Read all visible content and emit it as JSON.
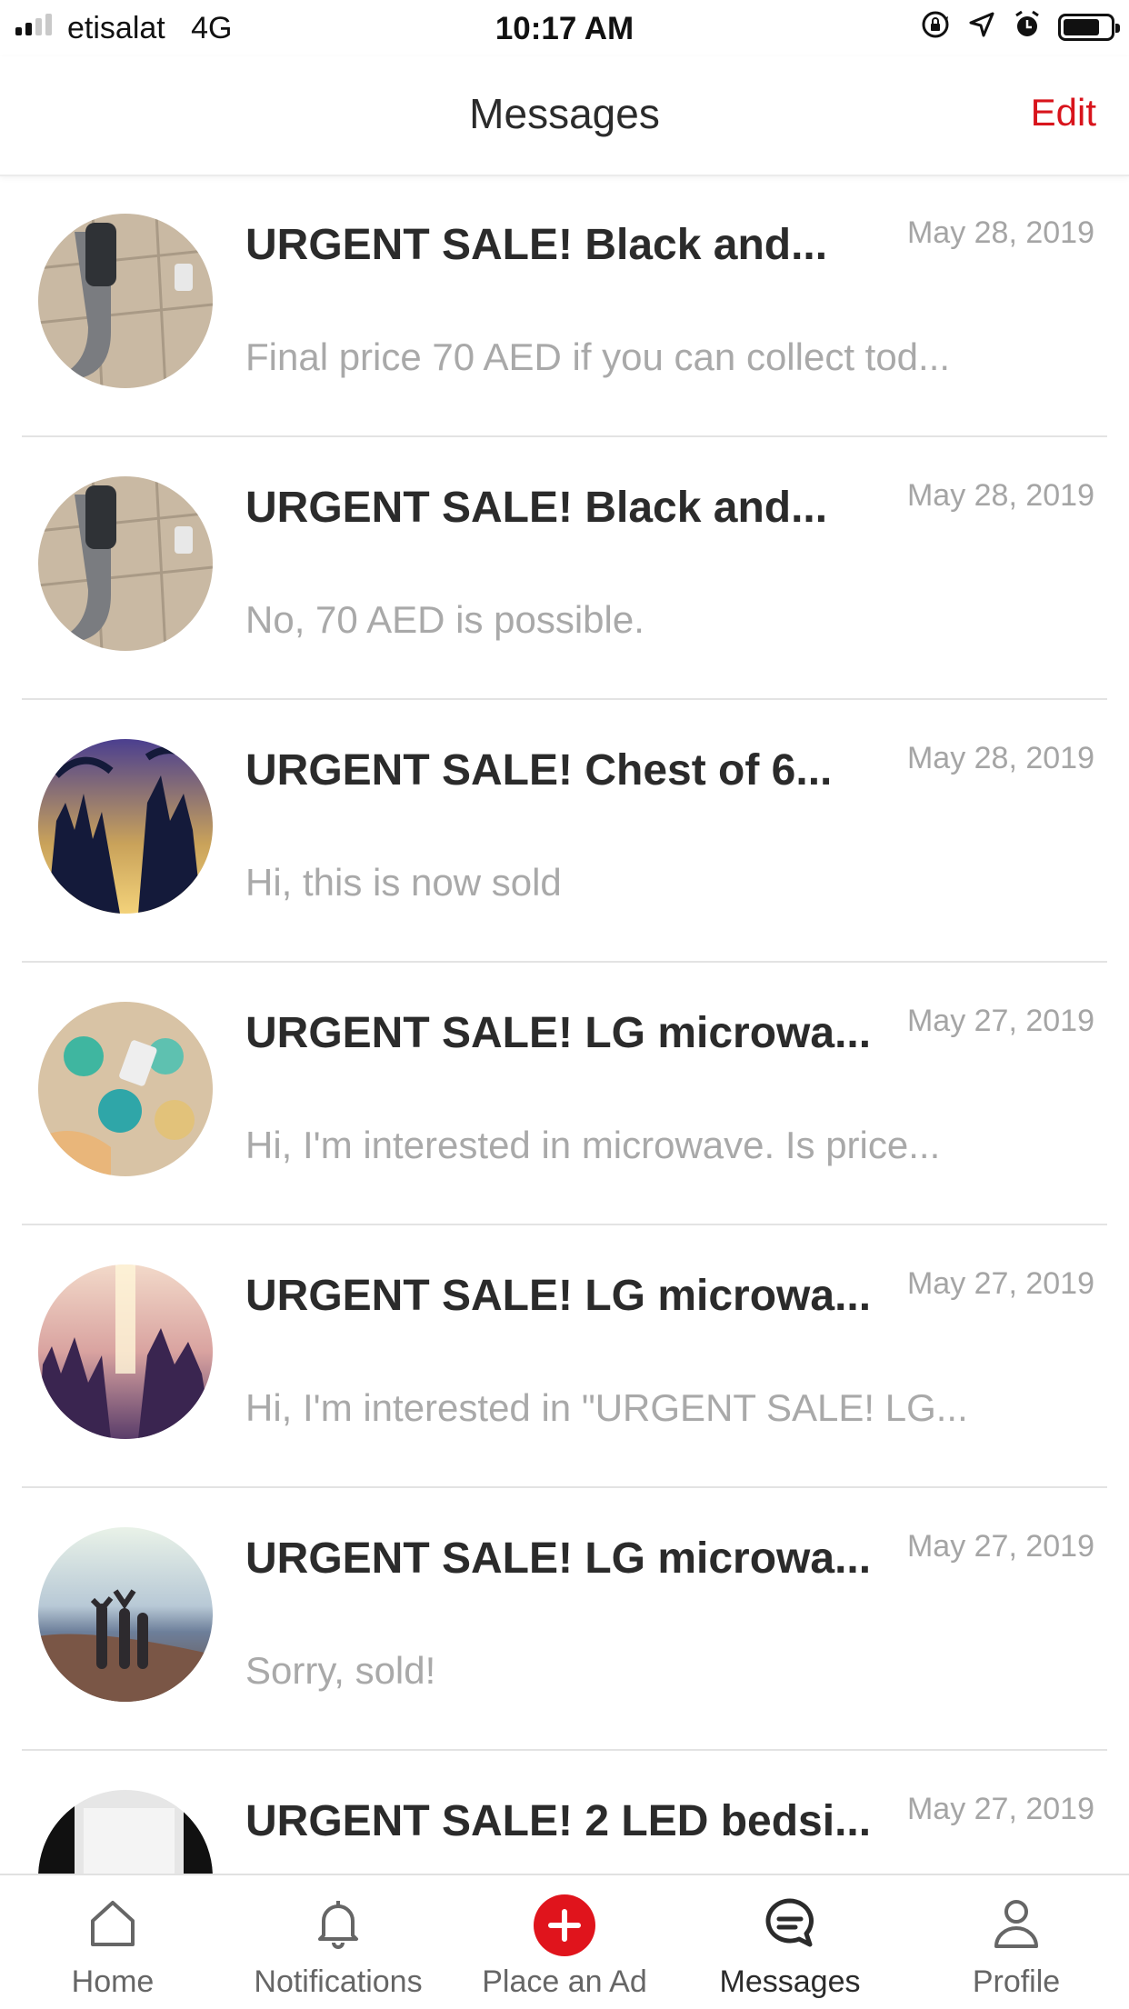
{
  "status_bar": {
    "carrier": "etisalat",
    "network": "4G",
    "time": "10:17 AM",
    "signal_bars_active": 2,
    "signal_bars_total": 4
  },
  "nav": {
    "title": "Messages",
    "edit_label": "Edit"
  },
  "accent_color": "#d8141c",
  "messages": [
    {
      "title": "URGENT SALE! Black and...",
      "date": "May 28, 2019",
      "sender": "",
      "preview": "Final price 70 AED if you can collect tod..."
    },
    {
      "title": "URGENT SALE! Black and...",
      "date": "May 28, 2019",
      "sender": "",
      "preview": "No, 70 AED is possible."
    },
    {
      "title": "URGENT SALE! Chest of 6...",
      "date": "May 28, 2019",
      "sender": "",
      "preview": "Hi, this is now sold"
    },
    {
      "title": "URGENT SALE! LG microwa...",
      "date": "May 27, 2019",
      "sender": "",
      "preview": "Hi, I'm interested in microwave. Is price..."
    },
    {
      "title": "URGENT SALE! LG microwa...",
      "date": "May 27, 2019",
      "sender": "",
      "preview": "Hi, I'm interested in \"URGENT SALE! LG..."
    },
    {
      "title": "URGENT SALE! LG microwa...",
      "date": "May 27, 2019",
      "sender": "",
      "preview": "Sorry, sold!"
    },
    {
      "title": "URGENT SALE! 2 LED bedsi...",
      "date": "May 27, 2019",
      "sender": "",
      "preview": ""
    }
  ],
  "tabs": [
    {
      "label": "Home",
      "icon": "home-icon"
    },
    {
      "label": "Notifications",
      "icon": "bell-icon"
    },
    {
      "label": "Place an Ad",
      "icon": "plus-circle-icon"
    },
    {
      "label": "Messages",
      "icon": "chat-bubble-icon",
      "active": true
    },
    {
      "label": "Profile",
      "icon": "person-icon"
    }
  ]
}
